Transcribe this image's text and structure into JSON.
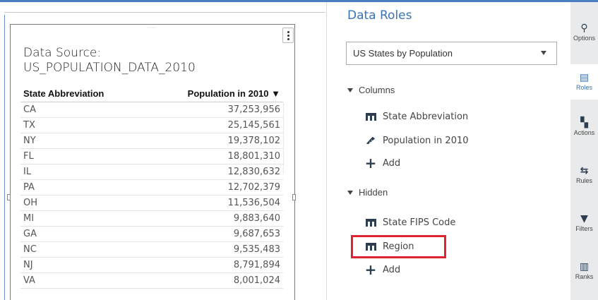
{
  "report": {
    "title_line1": "Data Source:",
    "title_line2": "US_POPULATION_DATA_2010",
    "table": {
      "columns": [
        "State Abbreviation",
        "Population in 2010 ▼"
      ],
      "rows": [
        [
          "CA",
          "37,253,956"
        ],
        [
          "TX",
          "25,145,561"
        ],
        [
          "NY",
          "19,378,102"
        ],
        [
          "FL",
          "18,801,310"
        ],
        [
          "IL",
          "12,830,632"
        ],
        [
          "PA",
          "12,702,379"
        ],
        [
          "OH",
          "11,536,504"
        ],
        [
          "MI",
          "9,883,640"
        ],
        [
          "GA",
          "9,687,653"
        ],
        [
          "NC",
          "9,535,483"
        ],
        [
          "NJ",
          "8,791,894"
        ],
        [
          "VA",
          "8,001,024"
        ]
      ]
    }
  },
  "panel": {
    "title": "Data Roles",
    "data_source_select": "US States by Population",
    "columns_section": "Columns",
    "columns_items": [
      "State Abbreviation",
      "Population in 2010"
    ],
    "add_label": "Add",
    "hidden_section": "Hidden",
    "hidden_items": [
      "State FIPS Code",
      "Region"
    ]
  },
  "toolbar": {
    "items": [
      {
        "label": "Options",
        "icon": "options-icon"
      },
      {
        "label": "Roles",
        "icon": "roles-icon"
      },
      {
        "label": "Actions",
        "icon": "actions-icon"
      },
      {
        "label": "Rules",
        "icon": "rules-icon"
      },
      {
        "label": "Filters",
        "icon": "filter-icon"
      },
      {
        "label": "Ranks",
        "icon": "ranks-icon"
      }
    ],
    "active": "Roles"
  },
  "colors": {
    "accent": "#3a74b5",
    "highlight": "#e0242f",
    "icon_dark": "#2d3e50"
  }
}
